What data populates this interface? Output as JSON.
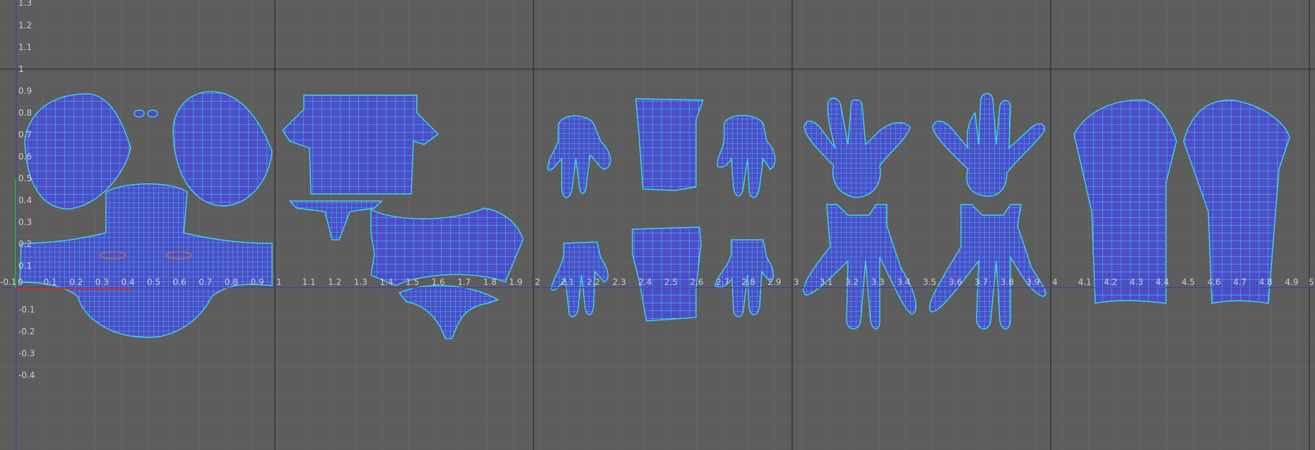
{
  "editor": {
    "background_color": "#5d5d5d",
    "grid_fine_color": "#6b6b6b",
    "grid_major_color": "#2e2e2e",
    "axis_color": "#3f3fb0",
    "origin_u_color": "#c03030",
    "origin_v_color": "#30a040",
    "shell_fill_color": "#4d4dc9",
    "shell_wire_color": "#3fd9f0",
    "u_range": [
      -0.1,
      5.0
    ],
    "v_range": [
      -0.4,
      1.3
    ],
    "u_tick_labels": [
      "-0.1",
      "0",
      "0.1",
      "0.2",
      "0.3",
      "0.4",
      "0.5",
      "0.6",
      "0.7",
      "0.8",
      "0.9",
      "1",
      "1.1",
      "1.2",
      "1.3",
      "1.4",
      "1.5",
      "1.6",
      "1.7",
      "1.8",
      "1.9",
      "2",
      "2.1",
      "2.2",
      "2.3",
      "2.4",
      "2.5",
      "2.6",
      "2.7",
      "2.8",
      "2.9",
      "3",
      "3.1",
      "3.2",
      "3.3",
      "3.4",
      "3.5",
      "3.6",
      "3.7",
      "3.8",
      "3.9",
      "4",
      "4.1",
      "4.2",
      "4.3",
      "4.4",
      "4.5",
      "4.6",
      "4.7",
      "4.8",
      "4.9",
      "5"
    ],
    "v_tick_labels": [
      "1.3",
      "1.2",
      "1.1",
      "1",
      "0.9",
      "0.8",
      "0.7",
      "0.6",
      "0.5",
      "0.4",
      "0.3",
      "0.2",
      "0.1",
      "-0.1",
      "-0.2",
      "-0.3",
      "-0.4"
    ]
  }
}
